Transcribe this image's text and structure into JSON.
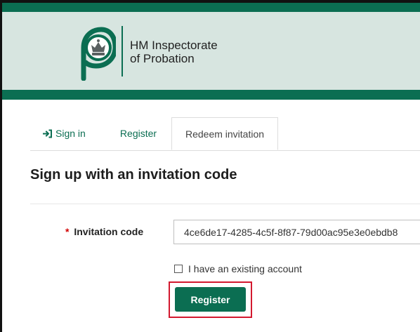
{
  "header": {
    "brand_line_1": "HM Inspectorate",
    "brand_line_2": "of Probation",
    "logo_icon": "probation-crown-logo-icon",
    "accent_color": "#0b6e52",
    "background_color": "#d7e5e0"
  },
  "tabs": {
    "sign_in": "Sign in",
    "register": "Register",
    "redeem_invitation": "Redeem invitation",
    "active_tab": "Redeem invitation",
    "sign_in_icon": "sign-in-icon"
  },
  "page": {
    "title": "Sign up with an invitation code"
  },
  "form": {
    "required_marker": "*",
    "invitation_code_label": "Invitation code",
    "invitation_code_value": "4ce6de17-4285-4c5f-8f87-79d00ac95e3e0ebdb8",
    "existing_account_label": "I have an existing account",
    "existing_account_checked": false,
    "register_button_label": "Register",
    "highlight_color": "#d3192f"
  }
}
